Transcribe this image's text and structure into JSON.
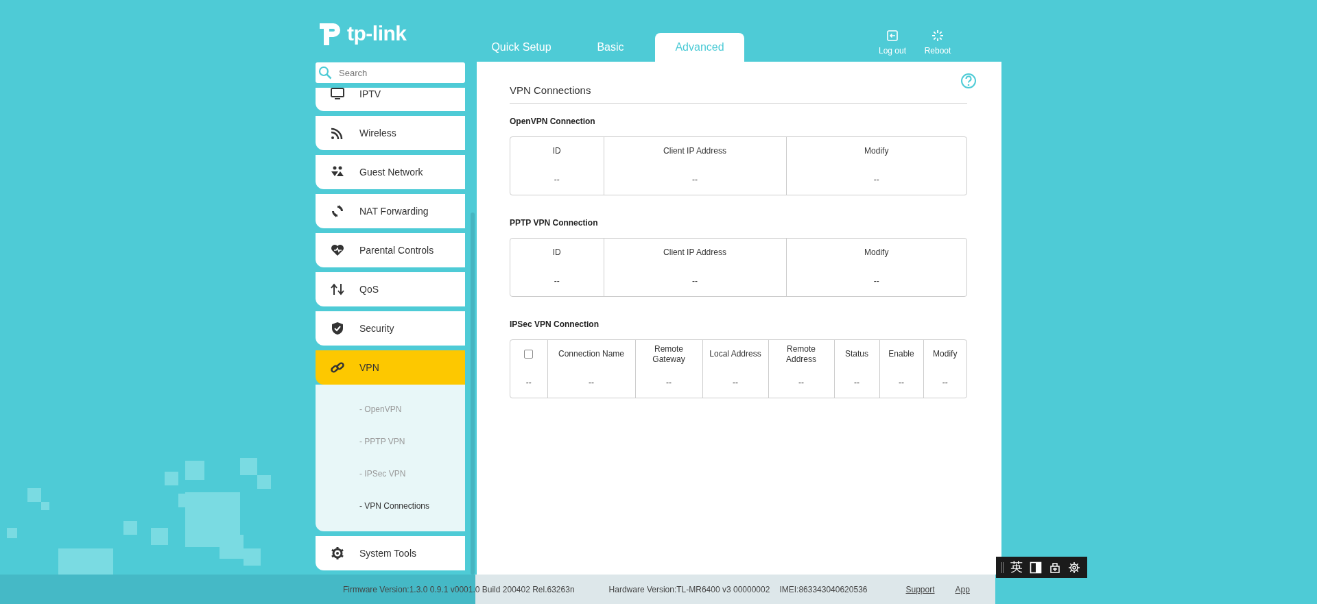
{
  "header": {
    "logo": "tp-link",
    "tabs": [
      {
        "label": "Quick Setup",
        "selected": false
      },
      {
        "label": "Basic",
        "selected": false
      },
      {
        "label": "Advanced",
        "selected": true
      }
    ],
    "actions": [
      {
        "label": "Log out",
        "kind": "logout"
      },
      {
        "label": "Reboot",
        "kind": "reboot"
      }
    ]
  },
  "search": {
    "placeholder": "Search"
  },
  "sidebar": {
    "items": [
      {
        "label": "IPTV",
        "kind": "tv",
        "selected": false
      },
      {
        "label": "Wireless",
        "kind": "wireless",
        "selected": false
      },
      {
        "label": "Guest Network",
        "kind": "guest",
        "selected": false
      },
      {
        "label": "NAT Forwarding",
        "kind": "nat",
        "selected": false
      },
      {
        "label": "Parental Controls",
        "kind": "parental",
        "selected": false
      },
      {
        "label": "QoS",
        "kind": "qos",
        "selected": false
      },
      {
        "label": "Security",
        "kind": "security",
        "selected": false
      },
      {
        "label": "VPN",
        "kind": "vpn",
        "selected": true,
        "expanded": true,
        "children": [
          {
            "label": "- OpenVPN",
            "selected": false
          },
          {
            "label": "- PPTP VPN",
            "selected": false
          },
          {
            "label": "- IPSec VPN",
            "selected": false
          },
          {
            "label": "- VPN Connections",
            "selected": true
          }
        ]
      },
      {
        "label": "System Tools",
        "kind": "tools",
        "selected": false
      }
    ]
  },
  "content": {
    "title": "VPN Connections",
    "sections": [
      {
        "heading": "OpenVPN Connection",
        "columns": [
          {
            "label": "ID"
          },
          {
            "label": "Client IP Address"
          },
          {
            "label": "Modify"
          }
        ],
        "rows": [
          [
            "--",
            "--",
            "--"
          ]
        ]
      },
      {
        "heading": "PPTP VPN Connection",
        "columns": [
          {
            "label": "ID"
          },
          {
            "label": "Client IP Address"
          },
          {
            "label": "Modify"
          }
        ],
        "rows": [
          [
            "--",
            "--",
            "--"
          ]
        ]
      },
      {
        "heading": "IPSec VPN Connection",
        "columns": [
          {
            "kind": "checkbox",
            "checked": false
          },
          {
            "label": "Connection Name"
          },
          {
            "label": "Remote Gateway"
          },
          {
            "label": "Local Address"
          },
          {
            "label": "Remote Address"
          },
          {
            "label": "Status"
          },
          {
            "label": "Enable"
          },
          {
            "label": "Modify"
          }
        ],
        "rows": [
          [
            "--",
            "--",
            "--",
            "--",
            "--",
            "--",
            "--",
            "--"
          ]
        ]
      }
    ]
  },
  "footer": {
    "firmware": "Firmware Version:1.3.0 0.9.1 v0001.0 Build 200402 Rel.63263n",
    "hardware": "Hardware Version:TL-MR6400 v3 00000002",
    "imei": "IMEI:863343040620536",
    "links": [
      "Support",
      "App"
    ]
  },
  "ime": {
    "mode": "英"
  }
}
